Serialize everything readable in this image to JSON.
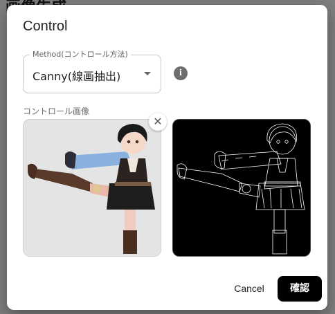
{
  "background_page": {
    "title": "画像生成"
  },
  "dialog": {
    "title": "Control",
    "method_select": {
      "label": "Method(コントロール方法)",
      "value": "Canny(線画抽出)"
    },
    "info_icon": "info-icon",
    "control_image_label": "コントロール画像",
    "remove_glyph": "✕",
    "actions": {
      "cancel_label": "Cancel",
      "confirm_label": "確認"
    }
  },
  "colors": {
    "primary_button": "#000000",
    "scrim": "rgba(0,0,0,0.5)",
    "edge_lines": "#ffffff"
  }
}
